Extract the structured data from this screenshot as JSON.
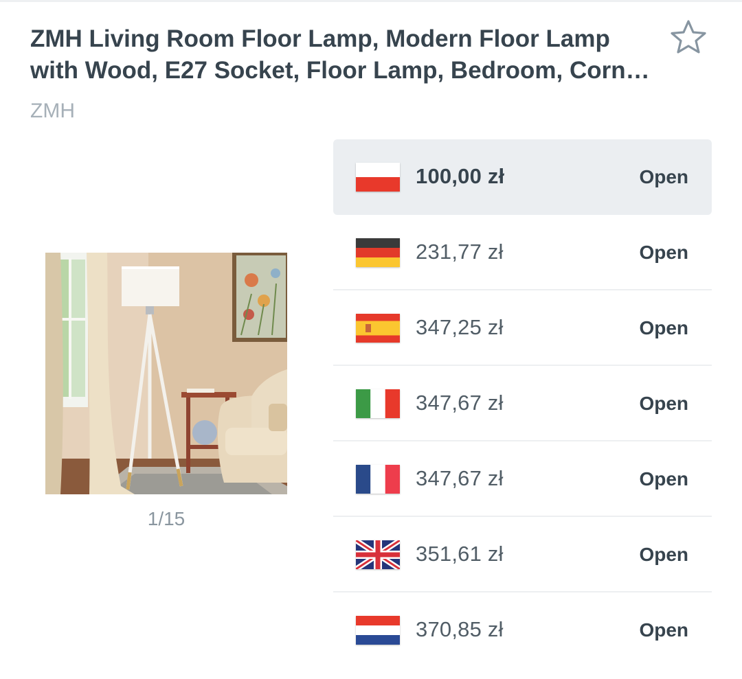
{
  "product": {
    "title": "ZMH Living Room Floor Lamp, Modern Floor Lamp with Wood, E27 Socket, Floor Lamp, Bedroom, Corner Lamp",
    "brand": "ZMH",
    "favorite_icon": "star-outline-icon"
  },
  "gallery": {
    "counter": "1/15"
  },
  "offers": [
    {
      "country": "Poland",
      "flag_icon": "flag-pl",
      "price": "100,00 zł",
      "action": "Open",
      "best": true
    },
    {
      "country": "Germany",
      "flag_icon": "flag-de",
      "price": "231,77 zł",
      "action": "Open"
    },
    {
      "country": "Spain",
      "flag_icon": "flag-es",
      "price": "347,25 zł",
      "action": "Open"
    },
    {
      "country": "Italy",
      "flag_icon": "flag-it",
      "price": "347,67 zł",
      "action": "Open"
    },
    {
      "country": "France",
      "flag_icon": "flag-fr",
      "price": "347,67 zł",
      "action": "Open"
    },
    {
      "country": "United Kingdom",
      "flag_icon": "flag-gb",
      "price": "351,61 zł",
      "action": "Open"
    },
    {
      "country": "Netherlands",
      "flag_icon": "flag-nl",
      "price": "370,85 zł",
      "action": "Open"
    }
  ],
  "colors": {
    "text_primary": "#37444e",
    "text_muted": "#a6b0b8",
    "highlight_bg": "#ebeef1",
    "divider": "#edeff1"
  }
}
